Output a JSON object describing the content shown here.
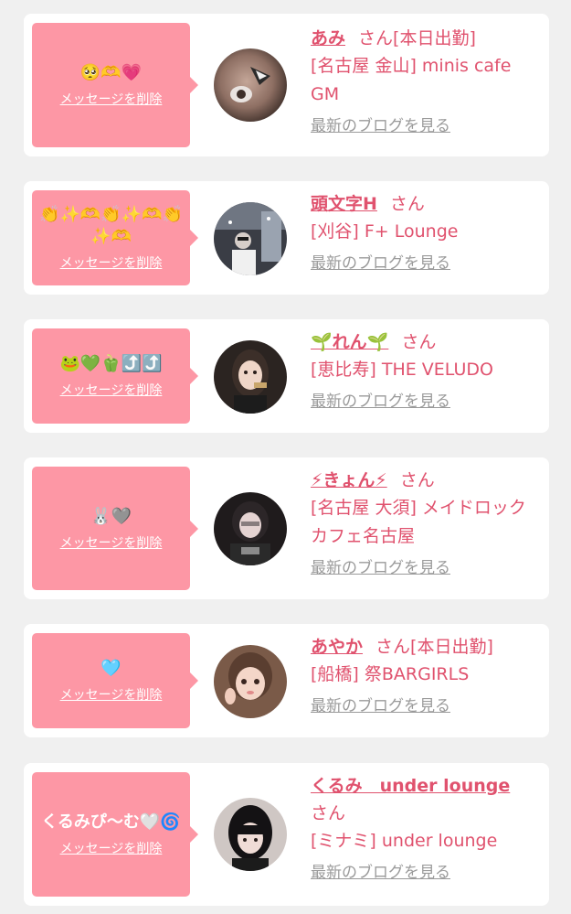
{
  "items": [
    {
      "message": "🥺🫶💗",
      "delete_label": "メッセージを削除",
      "name": "あみ",
      "san": "さん",
      "status": "[本日出勤]",
      "shop": "[名古屋 金山] minis cafe GM",
      "blog_label": "最新のブログを見る",
      "avatar_colors": [
        "#4b3a33",
        "#a88b7d"
      ]
    },
    {
      "message": "👏✨🫶👏✨🫶👏✨🫶",
      "delete_label": "メッセージを削除",
      "name": "頭文字H",
      "san": "さん",
      "status": "",
      "shop": "[刈谷] F+ Lounge",
      "blog_label": "最新のブログを見る",
      "avatar_colors": [
        "#2a2c33",
        "#8f97a4"
      ]
    },
    {
      "message": "🐸💚🫑⤴️⤴️",
      "delete_label": "メッセージを削除",
      "name": "🌱れん🌱",
      "san": "さん",
      "status": "",
      "shop": "[恵比寿] THE VELUDO",
      "blog_label": "最新のブログを見る",
      "avatar_colors": [
        "#3a302b",
        "#e6c8b8"
      ]
    },
    {
      "message": "🐰🩶",
      "delete_label": "メッセージを削除",
      "name": "⚡きょん⚡",
      "san": "さん",
      "status": "",
      "shop": "[名古屋 大須] メイドロックカフェ名古屋",
      "blog_label": "最新のブログを見る",
      "avatar_colors": [
        "#1f1b1c",
        "#d9c4c4"
      ]
    },
    {
      "message": "🩵",
      "delete_label": "メッセージを削除",
      "name": "あやか",
      "san": "さん",
      "status": "[本日出勤]",
      "shop": "[船橋] 祭BARGIRLS",
      "blog_label": "最新のブログを見る",
      "avatar_colors": [
        "#6a4a3a",
        "#f2d0c2"
      ]
    },
    {
      "message": "くるみぴ〜む🤍🌀",
      "delete_label": "メッセージを削除",
      "name": "くるみ　under lounge",
      "san": "さん",
      "status": "",
      "shop": "[ミナミ] under lounge",
      "blog_label": "最新のブログを見る",
      "avatar_colors": [
        "#141214",
        "#e8d4cf"
      ]
    }
  ]
}
